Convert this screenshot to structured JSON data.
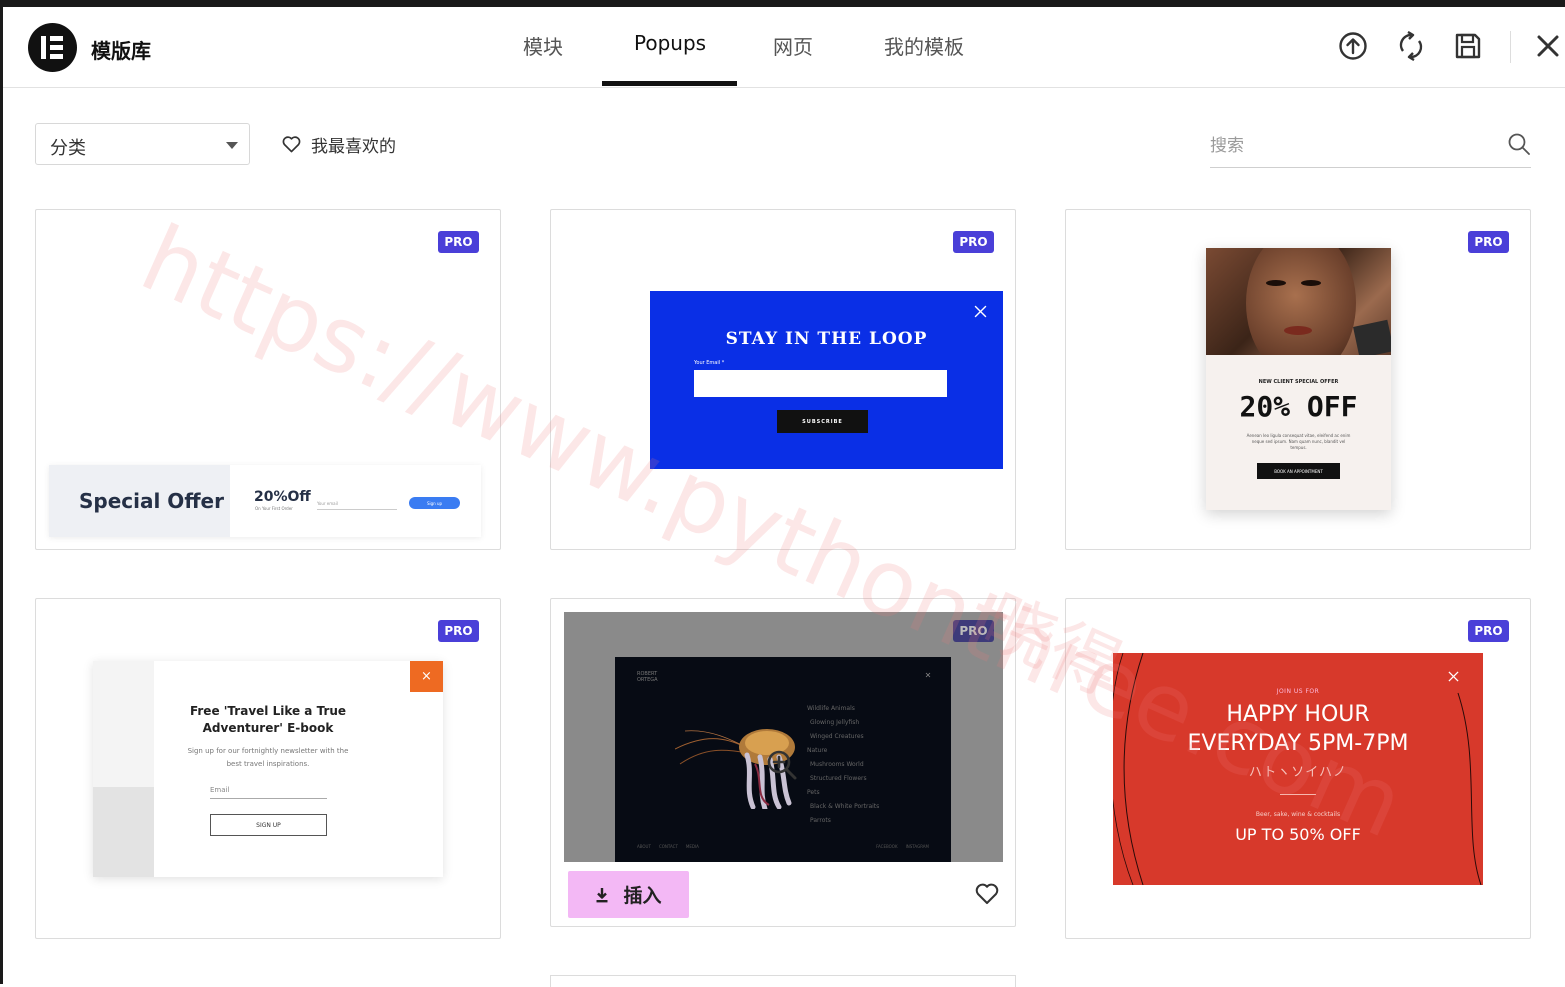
{
  "app": {
    "title": "模版库"
  },
  "tabs": [
    {
      "label": "模块"
    },
    {
      "label": "Popups"
    },
    {
      "label": "网页"
    },
    {
      "label": "我的模板"
    }
  ],
  "filters": {
    "category_value": "分类",
    "favorites_label": "我最喜欢的",
    "search_placeholder": "搜索"
  },
  "badge": {
    "pro": "PRO"
  },
  "cards": [
    {
      "title": "Special Offer",
      "discount": "20%Off",
      "sub": "On Your First Order",
      "input_hint": "Your email",
      "button": "Sign up"
    },
    {
      "title": "STAY IN THE LOOP",
      "field_label": "Your Email *",
      "button": "SUBSCRIBE"
    },
    {
      "kicker": "NEW CLIENT SPECIAL OFFER",
      "title": "20% OFF",
      "body": "Aenean leo ligula consequat vitae, eleifend ac enim neque sed ipsum. Nam quam nunc, blandit vel tempus.",
      "button": "BOOK AN APPOINTMENT"
    },
    {
      "title": "Free 'Travel Like a True Adventurer' E-book",
      "body": "Sign up for our fortnightly newsletter with the best travel inspirations.",
      "field_label": "Email",
      "button": "SIGN UP",
      "close": "×"
    },
    {
      "brand": "ROBERT ORTEGA",
      "menu": [
        "Wildlife Animals",
        "Glowing Jellyfish",
        "Winged Creatures",
        "Nature",
        "Mushrooms World",
        "Structured Flowers",
        "Pets",
        "Black & White Portraits",
        "Parrots"
      ],
      "footer_left": [
        "ABOUT",
        "CONTACT",
        "MEDIA"
      ],
      "footer_right": [
        "FACEBOOK",
        "INSTAGRAM"
      ],
      "insert_label": "插入"
    },
    {
      "kicker": "JOIN US FOR",
      "title_line1": "HAPPY HOUR",
      "title_line2": "EVERYDAY 5PM-7PM",
      "script": "ハトヽソイハノ",
      "sub": "Beer, sake, wine & cocktails",
      "offer": "UP TO 50% OFF"
    }
  ],
  "watermark": {
    "text": "https://www.pythonthree.com",
    "text2": "晓得"
  },
  "colors": {
    "accent_pro": "#4a3fd8",
    "blue_popup": "#0a2fe6",
    "red_popup": "#d7392b",
    "insert_button": "#f3b8f5",
    "orange_close": "#ee6a22"
  }
}
